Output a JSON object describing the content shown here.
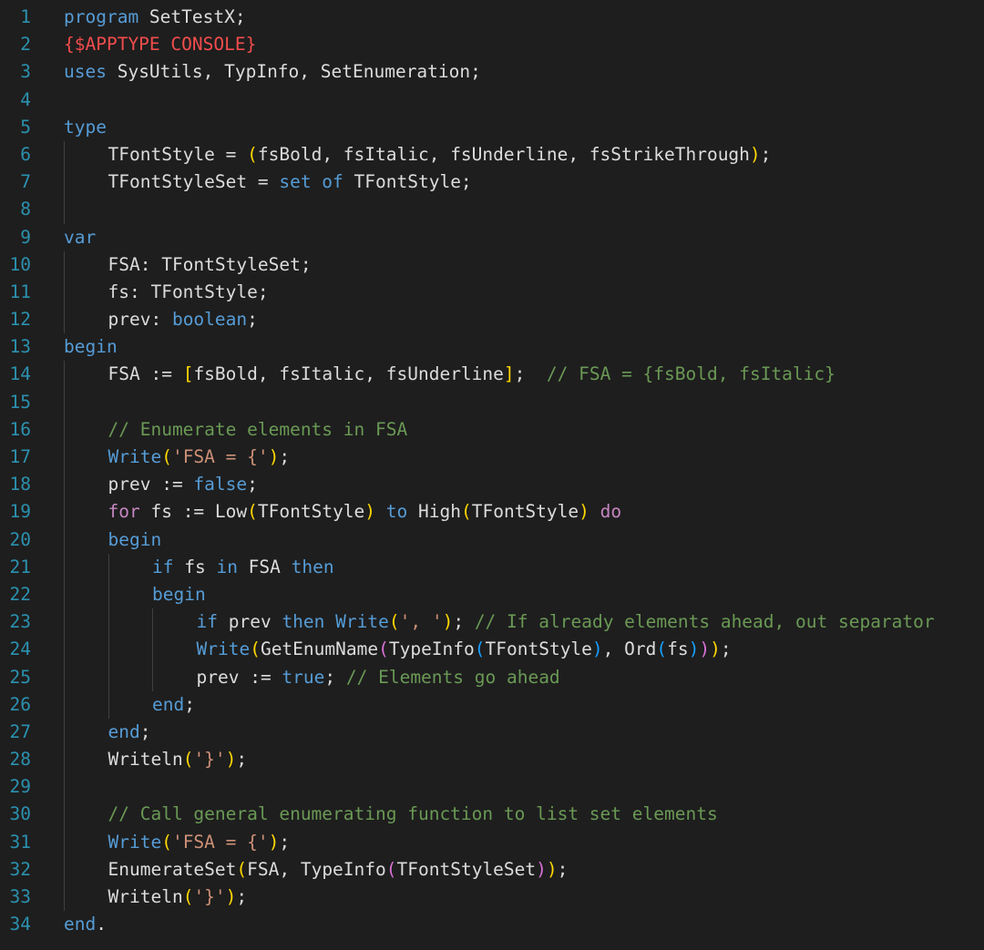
{
  "colors": {
    "background": "#1e1e1e",
    "line_number": "#2b91af",
    "text": "#dcdcdc",
    "keyword": "#569cd6",
    "control": "#c586c0",
    "directive": "#f14c4c",
    "string": "#ce9178",
    "comment": "#6a9955",
    "paren_level1": "#ffd700",
    "paren_level2": "#da70d6",
    "paren_level3": "#179fff",
    "indent_guide": "#404040"
  },
  "lines": [
    {
      "n": "1",
      "indent": 0,
      "tokens": [
        {
          "t": "kw",
          "v": "program"
        },
        {
          "t": "txt",
          "v": " SetTestX;"
        }
      ]
    },
    {
      "n": "2",
      "indent": 0,
      "tokens": [
        {
          "t": "dir",
          "v": "{$APPTYPE CONSOLE}"
        }
      ]
    },
    {
      "n": "3",
      "indent": 0,
      "tokens": [
        {
          "t": "kw",
          "v": "uses"
        },
        {
          "t": "txt",
          "v": " SysUtils, TypInfo, SetEnumeration;"
        }
      ]
    },
    {
      "n": "4",
      "indent": 0,
      "tokens": []
    },
    {
      "n": "5",
      "indent": 0,
      "tokens": [
        {
          "t": "kw",
          "v": "type"
        }
      ]
    },
    {
      "n": "6",
      "indent": 1,
      "tokens": [
        {
          "t": "txt",
          "v": "TFontStyle = "
        },
        {
          "t": "p1",
          "v": "("
        },
        {
          "t": "txt",
          "v": "fsBold, fsItalic, fsUnderline, fsStrikeThrough"
        },
        {
          "t": "p1",
          "v": ")"
        },
        {
          "t": "txt",
          "v": ";"
        }
      ]
    },
    {
      "n": "7",
      "indent": 1,
      "tokens": [
        {
          "t": "txt",
          "v": "TFontStyleSet = "
        },
        {
          "t": "kw",
          "v": "set of"
        },
        {
          "t": "txt",
          "v": " TFontStyle;"
        }
      ]
    },
    {
      "n": "8",
      "indent": 1,
      "tokens": []
    },
    {
      "n": "9",
      "indent": 0,
      "tokens": [
        {
          "t": "kw",
          "v": "var"
        }
      ]
    },
    {
      "n": "10",
      "indent": 1,
      "tokens": [
        {
          "t": "txt",
          "v": "FSA: TFontStyleSet;"
        }
      ]
    },
    {
      "n": "11",
      "indent": 1,
      "tokens": [
        {
          "t": "txt",
          "v": "fs: TFontStyle;"
        }
      ]
    },
    {
      "n": "12",
      "indent": 1,
      "tokens": [
        {
          "t": "txt",
          "v": "prev: "
        },
        {
          "t": "kw",
          "v": "boolean"
        },
        {
          "t": "txt",
          "v": ";"
        }
      ]
    },
    {
      "n": "13",
      "indent": 0,
      "tokens": [
        {
          "t": "kw",
          "v": "begin"
        }
      ]
    },
    {
      "n": "14",
      "indent": 1,
      "tokens": [
        {
          "t": "txt",
          "v": "FSA := "
        },
        {
          "t": "p1",
          "v": "["
        },
        {
          "t": "txt",
          "v": "fsBold, fsItalic, fsUnderline"
        },
        {
          "t": "p1",
          "v": "]"
        },
        {
          "t": "txt",
          "v": ";  "
        },
        {
          "t": "cm",
          "v": "// FSA = {fsBold, fsItalic}"
        }
      ]
    },
    {
      "n": "15",
      "indent": 1,
      "tokens": []
    },
    {
      "n": "16",
      "indent": 1,
      "tokens": [
        {
          "t": "cm",
          "v": "// Enumerate elements in FSA"
        }
      ]
    },
    {
      "n": "17",
      "indent": 1,
      "tokens": [
        {
          "t": "kw",
          "v": "Write"
        },
        {
          "t": "p1",
          "v": "("
        },
        {
          "t": "str",
          "v": "'FSA = {'"
        },
        {
          "t": "p1",
          "v": ")"
        },
        {
          "t": "txt",
          "v": ";"
        }
      ]
    },
    {
      "n": "18",
      "indent": 1,
      "tokens": [
        {
          "t": "txt",
          "v": "prev := "
        },
        {
          "t": "kw",
          "v": "false"
        },
        {
          "t": "txt",
          "v": ";"
        }
      ]
    },
    {
      "n": "19",
      "indent": 1,
      "tokens": [
        {
          "t": "ctl",
          "v": "for"
        },
        {
          "t": "txt",
          "v": " fs := Low"
        },
        {
          "t": "p1",
          "v": "("
        },
        {
          "t": "txt",
          "v": "TFontStyle"
        },
        {
          "t": "p1",
          "v": ")"
        },
        {
          "t": "txt",
          "v": " "
        },
        {
          "t": "kw",
          "v": "to"
        },
        {
          "t": "txt",
          "v": " High"
        },
        {
          "t": "p1",
          "v": "("
        },
        {
          "t": "txt",
          "v": "TFontStyle"
        },
        {
          "t": "p1",
          "v": ")"
        },
        {
          "t": "txt",
          "v": " "
        },
        {
          "t": "ctl",
          "v": "do"
        }
      ]
    },
    {
      "n": "20",
      "indent": 1,
      "tokens": [
        {
          "t": "kw",
          "v": "begin"
        }
      ]
    },
    {
      "n": "21",
      "indent": 2,
      "tokens": [
        {
          "t": "kw",
          "v": "if"
        },
        {
          "t": "txt",
          "v": " fs "
        },
        {
          "t": "kw",
          "v": "in"
        },
        {
          "t": "txt",
          "v": " FSA "
        },
        {
          "t": "kw",
          "v": "then"
        }
      ]
    },
    {
      "n": "22",
      "indent": 2,
      "tokens": [
        {
          "t": "kw",
          "v": "begin"
        }
      ]
    },
    {
      "n": "23",
      "indent": 3,
      "tokens": [
        {
          "t": "kw",
          "v": "if"
        },
        {
          "t": "txt",
          "v": " prev "
        },
        {
          "t": "kw",
          "v": "then"
        },
        {
          "t": "txt",
          "v": " "
        },
        {
          "t": "kw",
          "v": "Write"
        },
        {
          "t": "p1",
          "v": "("
        },
        {
          "t": "str",
          "v": "', '"
        },
        {
          "t": "p1",
          "v": ")"
        },
        {
          "t": "txt",
          "v": "; "
        },
        {
          "t": "cm",
          "v": "// If already elements ahead, out separator"
        }
      ]
    },
    {
      "n": "24",
      "indent": 3,
      "tokens": [
        {
          "t": "kw",
          "v": "Write"
        },
        {
          "t": "p1",
          "v": "("
        },
        {
          "t": "txt",
          "v": "GetEnumName"
        },
        {
          "t": "p2",
          "v": "("
        },
        {
          "t": "txt",
          "v": "TypeInfo"
        },
        {
          "t": "p3",
          "v": "("
        },
        {
          "t": "txt",
          "v": "TFontStyle"
        },
        {
          "t": "p3",
          "v": ")"
        },
        {
          "t": "txt",
          "v": ", Ord"
        },
        {
          "t": "p3",
          "v": "("
        },
        {
          "t": "txt",
          "v": "fs"
        },
        {
          "t": "p3",
          "v": ")"
        },
        {
          "t": "p2",
          "v": ")"
        },
        {
          "t": "p1",
          "v": ")"
        },
        {
          "t": "txt",
          "v": ";"
        }
      ]
    },
    {
      "n": "25",
      "indent": 3,
      "tokens": [
        {
          "t": "txt",
          "v": "prev := "
        },
        {
          "t": "kw",
          "v": "true"
        },
        {
          "t": "txt",
          "v": "; "
        },
        {
          "t": "cm",
          "v": "// Elements go ahead"
        }
      ]
    },
    {
      "n": "26",
      "indent": 2,
      "tokens": [
        {
          "t": "kw",
          "v": "end"
        },
        {
          "t": "txt",
          "v": ";"
        }
      ]
    },
    {
      "n": "27",
      "indent": 1,
      "tokens": [
        {
          "t": "kw",
          "v": "end"
        },
        {
          "t": "txt",
          "v": ";"
        }
      ]
    },
    {
      "n": "28",
      "indent": 1,
      "tokens": [
        {
          "t": "txt",
          "v": "Writeln"
        },
        {
          "t": "p1",
          "v": "("
        },
        {
          "t": "str",
          "v": "'}'"
        },
        {
          "t": "p1",
          "v": ")"
        },
        {
          "t": "txt",
          "v": ";"
        }
      ]
    },
    {
      "n": "29",
      "indent": 1,
      "tokens": []
    },
    {
      "n": "30",
      "indent": 1,
      "tokens": [
        {
          "t": "cm",
          "v": "// Call general enumerating function to list set elements"
        }
      ]
    },
    {
      "n": "31",
      "indent": 1,
      "tokens": [
        {
          "t": "kw",
          "v": "Write"
        },
        {
          "t": "p1",
          "v": "("
        },
        {
          "t": "str",
          "v": "'FSA = {'"
        },
        {
          "t": "p1",
          "v": ")"
        },
        {
          "t": "txt",
          "v": ";"
        }
      ]
    },
    {
      "n": "32",
      "indent": 1,
      "tokens": [
        {
          "t": "txt",
          "v": "EnumerateSet"
        },
        {
          "t": "p1",
          "v": "("
        },
        {
          "t": "txt",
          "v": "FSA, TypeInfo"
        },
        {
          "t": "p2",
          "v": "("
        },
        {
          "t": "txt",
          "v": "TFontStyleSet"
        },
        {
          "t": "p2",
          "v": ")"
        },
        {
          "t": "p1",
          "v": ")"
        },
        {
          "t": "txt",
          "v": ";"
        }
      ]
    },
    {
      "n": "33",
      "indent": 1,
      "tokens": [
        {
          "t": "txt",
          "v": "Writeln"
        },
        {
          "t": "p1",
          "v": "("
        },
        {
          "t": "str",
          "v": "'}'"
        },
        {
          "t": "p1",
          "v": ")"
        },
        {
          "t": "txt",
          "v": ";"
        }
      ]
    },
    {
      "n": "34",
      "indent": 0,
      "tokens": [
        {
          "t": "kw",
          "v": "end"
        },
        {
          "t": "txt",
          "v": "."
        }
      ]
    }
  ]
}
